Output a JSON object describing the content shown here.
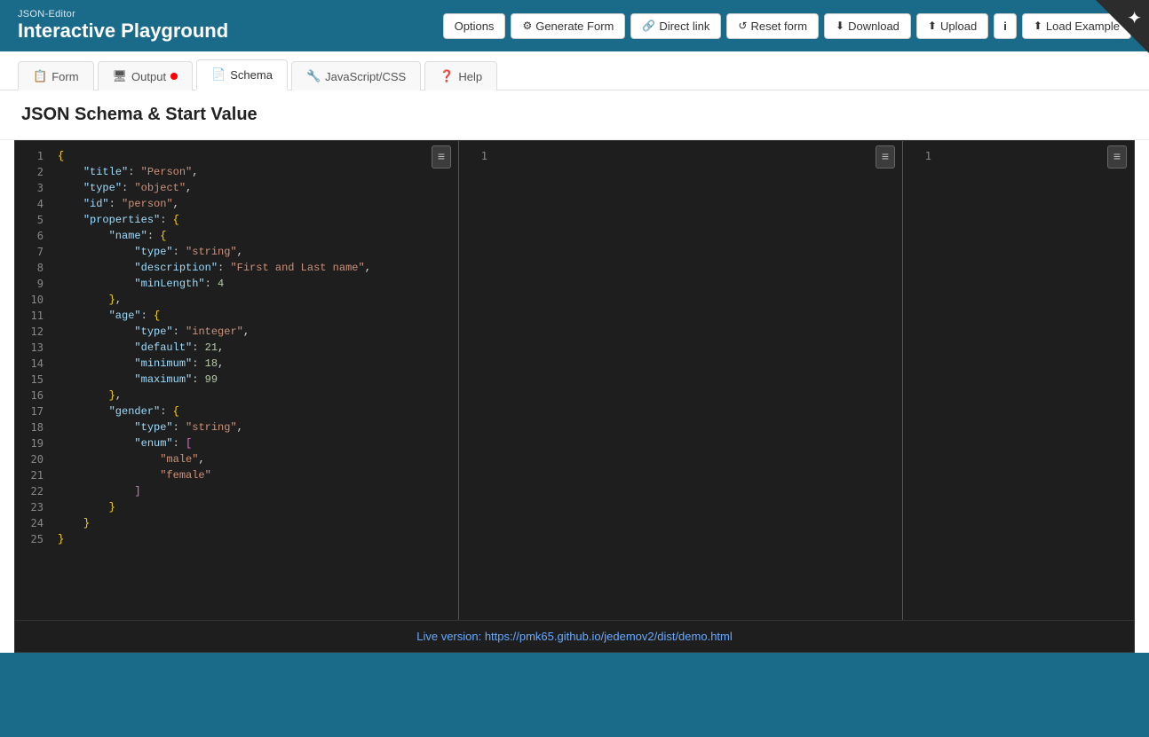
{
  "header": {
    "subtitle": "JSON-Editor",
    "title": "Interactive Playground"
  },
  "toolbar": {
    "options_label": "Options",
    "generate_form_label": "Generate Form",
    "direct_link_label": "Direct link",
    "reset_form_label": "Reset form",
    "download_label": "Download",
    "upload_label": "Upload",
    "info_label": "i",
    "load_example_label": "Load Example"
  },
  "tabs": [
    {
      "label": "Form",
      "icon": "📋",
      "active": false,
      "has_dot": false
    },
    {
      "label": "Output",
      "icon": "🖥",
      "active": false,
      "has_dot": true
    },
    {
      "label": "Schema",
      "icon": "📄",
      "active": true,
      "has_dot": false
    },
    {
      "label": "JavaScript/CSS",
      "icon": "🔧",
      "active": false,
      "has_dot": false
    },
    {
      "label": "Help",
      "icon": "❓",
      "active": false,
      "has_dot": false
    }
  ],
  "section_title": "JSON Schema & Start Value",
  "editor": {
    "left_menu_icon": "≡",
    "right_menu_icon": "≡",
    "code_lines": [
      {
        "num": 1,
        "text": "{"
      },
      {
        "num": 2,
        "text": "    \"title\": \"Person\","
      },
      {
        "num": 3,
        "text": "    \"type\": \"object\","
      },
      {
        "num": 4,
        "text": "    \"id\": \"person\","
      },
      {
        "num": 5,
        "text": "    \"properties\": {"
      },
      {
        "num": 6,
        "text": "        \"name\": {"
      },
      {
        "num": 7,
        "text": "            \"type\": \"string\","
      },
      {
        "num": 8,
        "text": "            \"description\": \"First and Last name\","
      },
      {
        "num": 9,
        "text": "            \"minLength\": 4"
      },
      {
        "num": 10,
        "text": "        },"
      },
      {
        "num": 11,
        "text": "        \"age\": {"
      },
      {
        "num": 12,
        "text": "            \"type\": \"integer\","
      },
      {
        "num": 13,
        "text": "            \"default\": 21,"
      },
      {
        "num": 14,
        "text": "            \"minimum\": 18,"
      },
      {
        "num": 15,
        "text": "            \"maximum\": 99"
      },
      {
        "num": 16,
        "text": "        },"
      },
      {
        "num": 17,
        "text": "        \"gender\": {"
      },
      {
        "num": 18,
        "text": "            \"type\": \"string\","
      },
      {
        "num": 19,
        "text": "            \"enum\": ["
      },
      {
        "num": 20,
        "text": "                \"male\","
      },
      {
        "num": 21,
        "text": "                \"female\""
      },
      {
        "num": 22,
        "text": "            ]"
      },
      {
        "num": 23,
        "text": "        }"
      },
      {
        "num": 24,
        "text": "    }"
      },
      {
        "num": 25,
        "text": "}"
      }
    ],
    "right_line_num": "1",
    "footer_text": "Live version: https://pmk65.github.io/jedemov2/dist/demo.html"
  },
  "colors": {
    "header_bg": "#1a6a8a",
    "editor_bg": "#1e1e1e",
    "active_tab_bg": "#ffffff"
  }
}
